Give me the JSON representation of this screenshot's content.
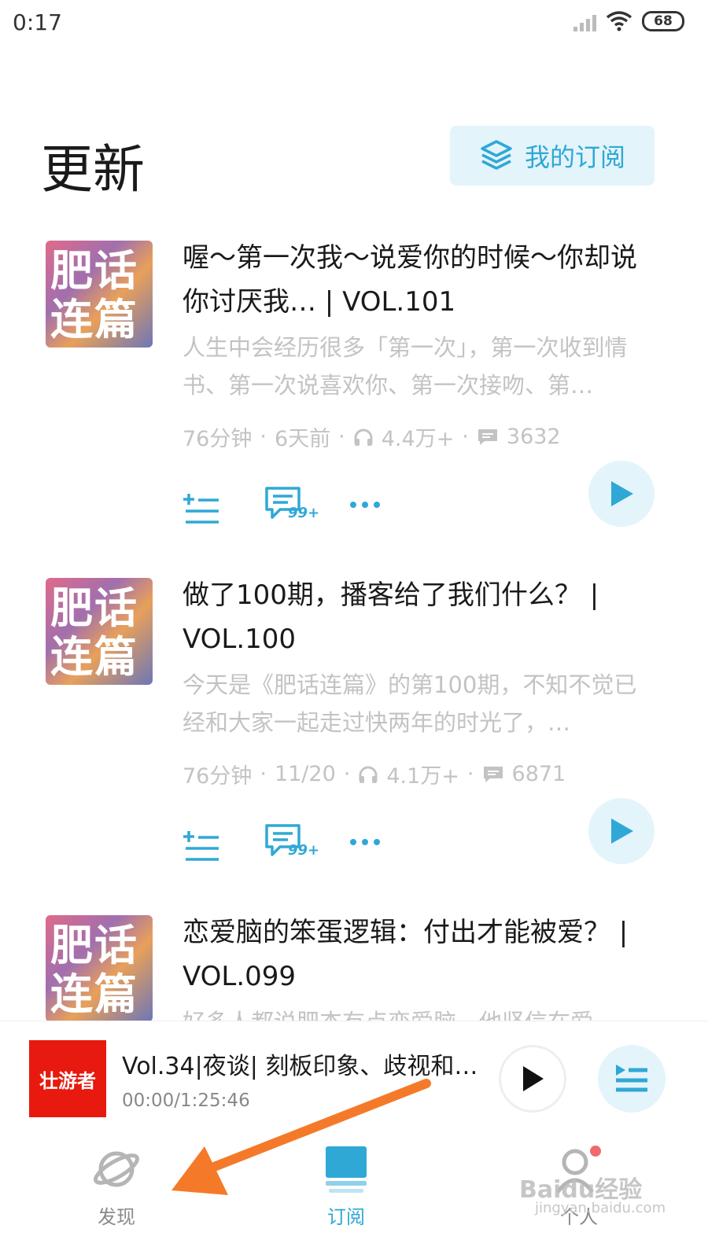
{
  "status_bar": {
    "time": "0:17",
    "battery": "68"
  },
  "header": {
    "title": "更新",
    "my_subscription_label": "我的订阅"
  },
  "episodes": [
    {
      "cover_text_line1": "肥话",
      "cover_text_line2": "连篇",
      "title": "喔～第一次我～说爱你的时候～你却说你讨厌我… | VOL.101",
      "description": "人生中会经历很多「第一次」，第一次收到情书、第一次说喜欢你、第一次接吻、第…",
      "duration": "76分钟",
      "date": "6天前",
      "plays": "4.4万+",
      "comments": "3632",
      "comment_badge": "99+"
    },
    {
      "cover_text_line1": "肥话",
      "cover_text_line2": "连篇",
      "title": "做了100期，播客给了我们什么？ | VOL.100",
      "description": "今天是《肥话连篇》的第100期，不知不觉已经和大家一起走过快两年的时光了，…",
      "duration": "76分钟",
      "date": "11/20",
      "plays": "4.1万+",
      "comments": "6871",
      "comment_badge": "99+"
    },
    {
      "cover_text_line1": "肥话",
      "cover_text_line2": "连篇",
      "title": "恋爱脑的笨蛋逻辑：付出才能被爱？ | VOL.099",
      "description": "好多人都说肥杰有点恋爱脑，他坚信在爱"
    }
  ],
  "mini_player": {
    "cover_text": "壮游者",
    "title": "Vol.34|夜谈| 刻板印象、歧视和…",
    "time": "00:00/1:25:46"
  },
  "bottom_nav": {
    "discover": "发现",
    "subscribe": "订阅",
    "profile": "个人"
  },
  "watermark": {
    "brand": "Baidu经验",
    "url": "jingyan.baidu.com"
  },
  "colors": {
    "accent": "#2fa8d6",
    "accent_bg": "#e4f4fb",
    "arrow": "#f47a2a"
  }
}
